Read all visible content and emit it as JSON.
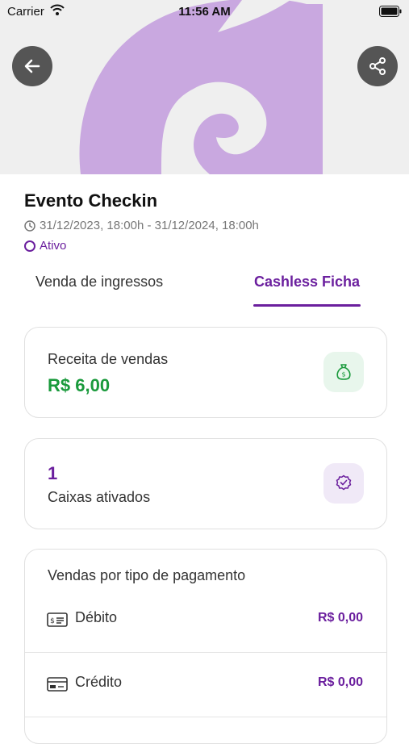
{
  "status_bar": {
    "carrier": "Carrier",
    "time": "11:56 AM"
  },
  "event": {
    "title": "Evento Checkin",
    "date_range": "31/12/2023, 18:00h - 31/12/2024, 18:00h",
    "status": "Ativo"
  },
  "tabs": [
    {
      "label": "Venda de ingressos",
      "active": false
    },
    {
      "label": "Cashless Ficha",
      "active": true
    }
  ],
  "revenue_card": {
    "label": "Receita de vendas",
    "value": "R$ 6,00",
    "icon": "money-bag-icon"
  },
  "cashier_card": {
    "count": "1",
    "label": "Caixas ativados",
    "icon": "verified-badge-icon"
  },
  "payments_card": {
    "title": "Vendas por tipo de pagamento",
    "items": [
      {
        "name": "Débito",
        "value": "R$ 0,00",
        "icon": "debit-card-icon"
      },
      {
        "name": "Crédito",
        "value": "R$ 0,00",
        "icon": "credit-card-icon"
      }
    ]
  },
  "colors": {
    "accent": "#6b1f9e",
    "success": "#1a9a3c",
    "hero_bg": "#efefef",
    "logo": "#c9a8e0"
  }
}
